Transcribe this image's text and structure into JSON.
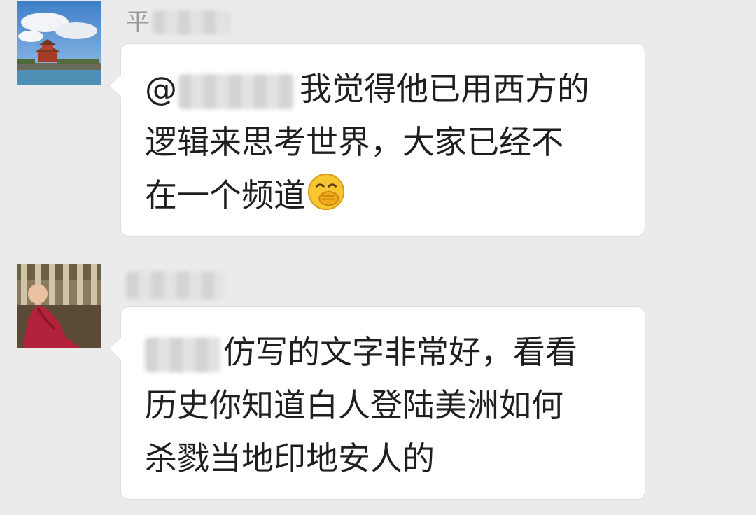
{
  "messages": [
    {
      "sender_visible": "平",
      "avatar": "forbidden-city-turret-photo",
      "mention_prefix": "@",
      "text": "我觉得他已用西方的\n逻辑来思考世界，大家已经不\n在一个频道",
      "emoji": "hand-over-mouth-emoji"
    },
    {
      "sender_visible": "",
      "avatar": "baby-monk-photo",
      "text": "仿写的文字非常好，看看\n历史你知道白人登陆美洲如何\n杀戮当地印地安人的"
    }
  ],
  "colors": {
    "background": "#ebebeb",
    "bubble": "#ffffff",
    "text": "#1f1f1f",
    "sender": "#9a9a9a"
  }
}
